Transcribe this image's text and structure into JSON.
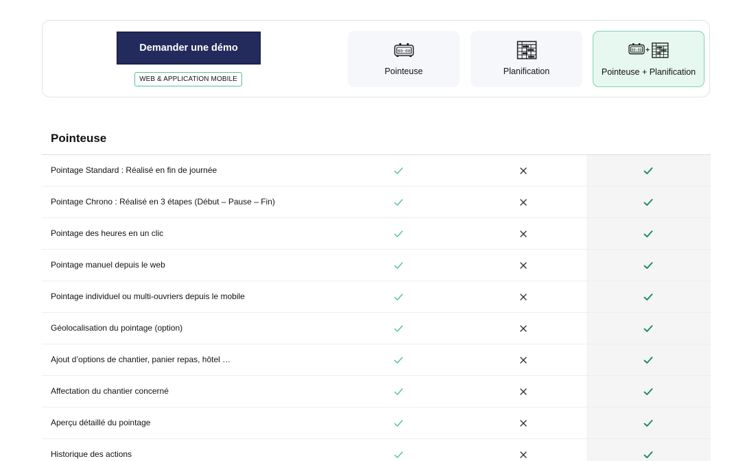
{
  "header": {
    "demo_button": "Demander une démo",
    "platform_badge": "WEB & APPLICATION MOBILE",
    "plans": [
      {
        "label": "Pointeuse",
        "icon": "time-clock-icon",
        "selected": false
      },
      {
        "label": "Planification",
        "icon": "planning-grid-icon",
        "selected": false
      },
      {
        "label": "Pointeuse + Planification",
        "icon": "time-clock-plus-planning-icon",
        "selected": true
      }
    ],
    "plus_sign": "+",
    "clock_digits": "00:00"
  },
  "section": {
    "title": "Pointeuse"
  },
  "features": [
    {
      "label": "Pointage Standard : Réalisé en fin de journée",
      "pointeuse": true,
      "planification": false,
      "combo": true
    },
    {
      "label": "Pointage Chrono : Réalisé en 3 étapes (Début – Pause – Fin)",
      "pointeuse": true,
      "planification": false,
      "combo": true
    },
    {
      "label": "Pointage des heures en un clic",
      "pointeuse": true,
      "planification": false,
      "combo": true
    },
    {
      "label": "Pointage manuel depuis le web",
      "pointeuse": true,
      "planification": false,
      "combo": true
    },
    {
      "label": "Pointage individuel ou multi-ouvriers depuis le mobile",
      "pointeuse": true,
      "planification": false,
      "combo": true
    },
    {
      "label": "Géolocalisation du pointage (option)",
      "pointeuse": true,
      "planification": false,
      "combo": true
    },
    {
      "label": "Ajout d’options de chantier, panier repas, hôtel …",
      "pointeuse": true,
      "planification": false,
      "combo": true
    },
    {
      "label": "Affectation du chantier concerné",
      "pointeuse": true,
      "planification": false,
      "combo": true
    },
    {
      "label": "Aperçu détaillé du pointage",
      "pointeuse": true,
      "planification": false,
      "combo": true
    },
    {
      "label": "Historique des actions",
      "pointeuse": true,
      "planification": false,
      "combo": true
    }
  ],
  "colors": {
    "demo_button_bg": "#232a5c",
    "badge_border": "#4fbf9a",
    "check_light": "#4fbf9a",
    "check_dark": "#0f8a6b",
    "cross": "#333333",
    "selected_card_bg": "#e6f8f0",
    "highlight_column_bg": "#f5f5f5"
  }
}
